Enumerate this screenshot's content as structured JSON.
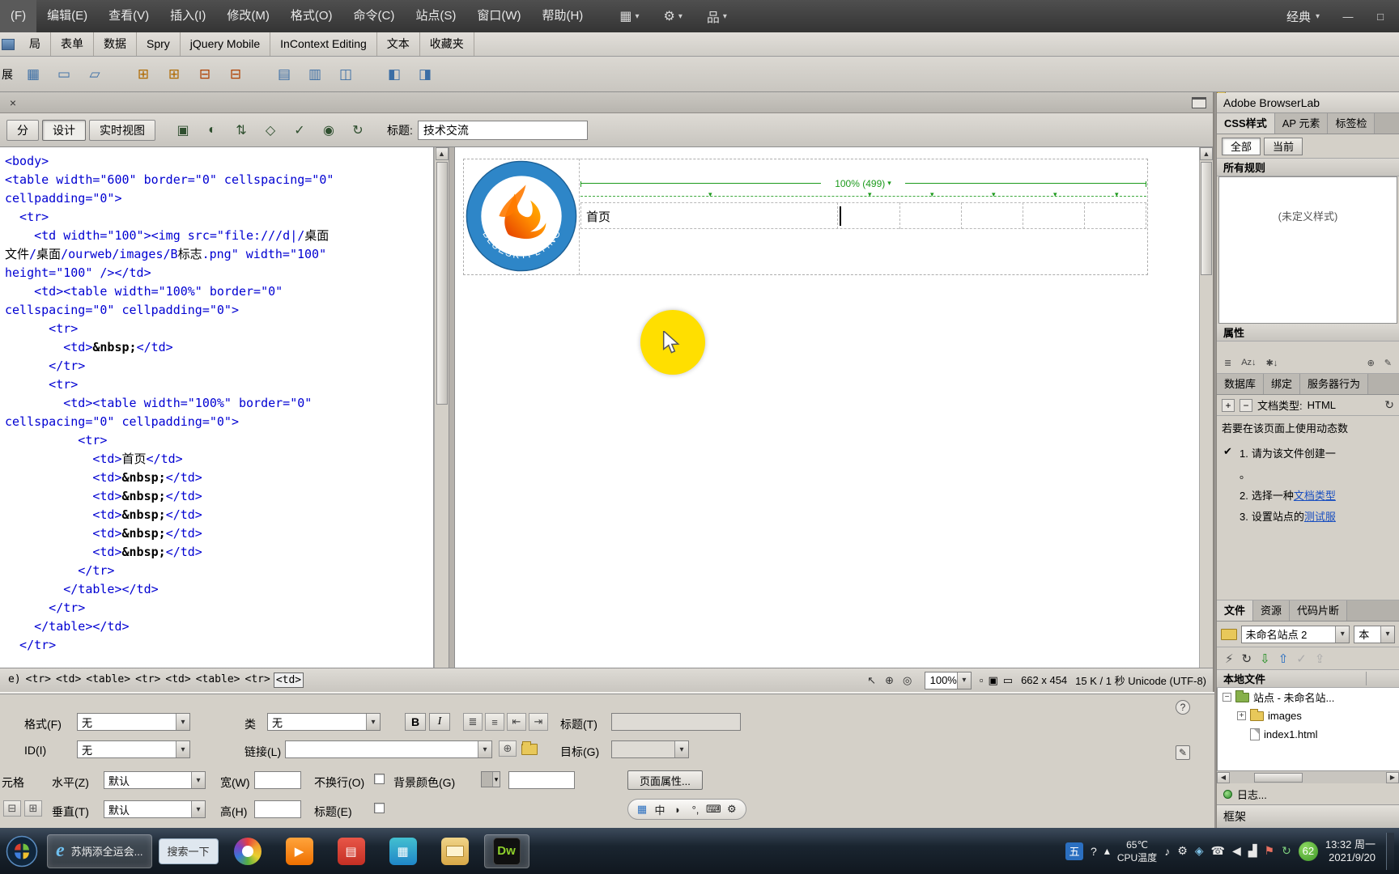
{
  "colors": {
    "guide_green": "#1c9a1c",
    "code_blue": "#0000d2",
    "click_yellow": "#ffdf00"
  },
  "ui": {
    "caret": "▾",
    "up_arrow": "▲",
    "down_arrow": "▼",
    "left_arrow": "◀",
    "right_arrow": "▶"
  },
  "window": {
    "workspace": "经典",
    "minimize": "—",
    "maximize": "□"
  },
  "menubar": {
    "items": [
      "(F)",
      "编辑(E)",
      "查看(V)",
      "插入(I)",
      "修改(M)",
      "格式(O)",
      "命令(C)",
      "站点(S)",
      "窗口(W)",
      "帮助(H)"
    ],
    "icons": [
      {
        "name": "layout-grid-icon",
        "glyph": "▦"
      },
      {
        "name": "extensions-gear-icon",
        "glyph": "⚙"
      },
      {
        "name": "site-structure-icon",
        "glyph": "品"
      }
    ]
  },
  "insert_bar": {
    "tabs": [
      "局",
      "表单",
      "数据",
      "Spry",
      "jQuery Mobile",
      "InContext Editing",
      "文本",
      "收藏夹"
    ]
  },
  "layout_bar": {
    "label": "展",
    "icons": [
      {
        "name": "insert-table-icon",
        "glyph": "▦",
        "color": "#3b6ea5"
      },
      {
        "name": "insert-div-icon",
        "glyph": "▭",
        "color": "#3b6ea5"
      },
      {
        "name": "draw-ap-div-icon",
        "glyph": "▱",
        "color": "#3b6ea5"
      },
      {
        "name": "insert-row-above-icon",
        "glyph": "⊞",
        "color": "#b06a00"
      },
      {
        "name": "insert-row-below-icon",
        "glyph": "⊞",
        "color": "#b06a00"
      },
      {
        "name": "insert-col-left-icon",
        "glyph": "⊟",
        "color": "#b04000"
      },
      {
        "name": "insert-col-right-icon",
        "glyph": "⊟",
        "color": "#b04000"
      },
      {
        "name": "standard-table-mode-icon",
        "glyph": "▤",
        "color": "#3b6ea5"
      },
      {
        "name": "expanded-table-mode-icon",
        "glyph": "▥",
        "color": "#3b6ea5"
      },
      {
        "name": "merge-cells-icon",
        "glyph": "◫",
        "color": "#3b6ea5"
      },
      {
        "name": "frame-left-icon",
        "glyph": "◧",
        "color": "#3b6ea5"
      },
      {
        "name": "frame-right-icon",
        "glyph": "◨",
        "color": "#3b6ea5"
      }
    ]
  },
  "doc": {
    "views": [
      {
        "name": "view-split-button",
        "label": "分",
        "active": false
      },
      {
        "name": "view-design-button",
        "label": "设计",
        "active": true
      },
      {
        "name": "view-live-button",
        "label": "实时视图",
        "active": false
      }
    ],
    "toolbar_icons": [
      {
        "name": "multiscreen-preview-icon",
        "glyph": "▣"
      },
      {
        "name": "preview-in-browser-icon",
        "glyph": "◐"
      },
      {
        "name": "file-management-icon",
        "glyph": "⇅"
      },
      {
        "name": "w3c-validation-icon",
        "glyph": "◇"
      },
      {
        "name": "browser-compatibility-icon",
        "glyph": "✓"
      },
      {
        "name": "visual-aids-icon",
        "glyph": "◉"
      },
      {
        "name": "refresh-design-icon",
        "glyph": "↻"
      }
    ],
    "title_label": "标题:",
    "title_value": "技术交流"
  },
  "code": {
    "lines": [
      "<body>",
      "<table width=\"600\" border=\"0\" cellspacing=\"0\"",
      "cellpadding=\"0\">",
      "  <tr>",
      "    <td width=\"100\"><img src=\"file:///d|/桌面",
      "文件/桌面/ourweb/images/B标志.png\" width=\"100\"",
      "height=\"100\" /></td>",
      "    <td><table width=\"100%\" border=\"0\"",
      "cellspacing=\"0\" cellpadding=\"0\">",
      "      <tr>",
      "        <td>&nbsp;</td>",
      "      </tr>",
      "      <tr>",
      "        <td><table width=\"100%\" border=\"0\"",
      "cellspacing=\"0\" cellpadding=\"0\">",
      "          <tr>",
      "            <td>首页</td>",
      "            <td>&nbsp;</td>",
      "            <td>&nbsp;</td>",
      "            <td>&nbsp;</td>",
      "            <td>&nbsp;</td>",
      "            <td>&nbsp;</td>",
      "          </tr>",
      "        </table></td>",
      "      </tr>",
      "    </table></td>",
      "  </tr>"
    ]
  },
  "design": {
    "logo_text": "BLUESKYFLYING",
    "width_indicator": "100% (499)",
    "nav_item": "首页",
    "cell_boundaries": [
      472,
      549,
      625,
      701,
      777
    ],
    "column_carets": [
      313,
      510,
      587,
      663,
      739,
      815
    ]
  },
  "status": {
    "tag_path": [
      "e)",
      "<tr>",
      "<td>",
      "<table>",
      "<tr>",
      "<td>",
      "<table>",
      "<tr>",
      "<td>"
    ],
    "tools": [
      {
        "name": "select-tool-icon",
        "glyph": "↖"
      },
      {
        "name": "hand-tool-icon",
        "glyph": "⊕"
      },
      {
        "name": "zoom-tool-icon",
        "glyph": "◎"
      }
    ],
    "zoom": "100%",
    "mini_icons": [
      {
        "name": "window-size-icon",
        "glyph": "▫"
      },
      {
        "name": "monitor-size-icon",
        "glyph": "▣"
      },
      {
        "name": "download-size-icon",
        "glyph": "▭"
      }
    ],
    "dimensions": "662 x 454",
    "info": "15 K / 1 秒 Unicode (UTF-8)"
  },
  "properties": {
    "format_label": "格式(F)",
    "format_value": "无",
    "class_label": "类",
    "class_value": "无",
    "bold_label": "B",
    "italic_label": "I",
    "list_icons": [
      {
        "name": "unordered-list-icon",
        "glyph": "≣"
      },
      {
        "name": "ordered-list-icon",
        "glyph": "≡"
      },
      {
        "name": "outdent-icon",
        "glyph": "⇤"
      },
      {
        "name": "indent-icon",
        "glyph": "⇥"
      }
    ],
    "title_label": "标题(T)",
    "id_label": "ID(I)",
    "id_value": "无",
    "link_label": "链接(L)",
    "target_label": "目标(G)",
    "cell_label": "元格",
    "horz_label": "水平(Z)",
    "horz_value": "默认",
    "vert_label": "垂直(T)",
    "vert_value": "默认",
    "width_label": "宽(W)",
    "height_label": "高(H)",
    "nowrap_label": "不换行(O)",
    "header_label": "标题(E)",
    "bg_label": "背景颜色(G)",
    "page_props_label": "页面属性...",
    "help_glyph": "?",
    "edit_glyph": "✎",
    "merge_glyph": "⊟",
    "split_glyph": "⊞"
  },
  "ime_bar": {
    "icons": [
      {
        "name": "ime-logo-icon",
        "glyph": "▦",
        "color": "#2b6fc0"
      },
      {
        "name": "ime-chinese-mode-icon",
        "glyph": "中",
        "color": "#222"
      },
      {
        "name": "ime-halfwidth-icon",
        "glyph": "◗",
        "color": "#222"
      },
      {
        "name": "ime-punctuation-icon",
        "glyph": "°,",
        "color": "#222"
      },
      {
        "name": "ime-keyboard-icon",
        "glyph": "⌨",
        "color": "#222"
      },
      {
        "name": "ime-settings-icon",
        "glyph": "⚙",
        "color": "#222"
      }
    ]
  },
  "dock": {
    "browserlab_title": "Adobe BrowserLab",
    "css_panel_tabs": [
      "CSS样式",
      "AP 元素",
      "标签检"
    ],
    "all_button": "全部",
    "current_button": "当前",
    "all_rules_label": "所有规则",
    "no_style_text": "(未定义样式)",
    "properties_label": "属性",
    "css_toolbar_left": [
      {
        "name": "show-category-view-icon",
        "glyph": "≣"
      },
      {
        "name": "show-list-view-icon",
        "glyph": "Az↓"
      },
      {
        "name": "show-set-properties-icon",
        "glyph": "✱↓"
      }
    ],
    "css_toolbar_right": [
      {
        "name": "new-css-rule-icon",
        "glyph": "⊕"
      },
      {
        "name": "edit-style-icon",
        "glyph": "✎"
      }
    ],
    "server_panel_tabs": [
      "数据库",
      "绑定",
      "服务器行为"
    ],
    "plus_label": "+",
    "minus_label": "−",
    "doctype_label": "文档类型:",
    "doctype_value": "HTML",
    "refresh_glyph": "↻",
    "dynamic_intro": "若要在该页面上使用动态数",
    "check_glyph": "✔",
    "steps": [
      {
        "num": "1.",
        "text": "请为该文件创建一",
        "link": ""
      },
      {
        "num": "2.",
        "text": "选择一种",
        "link": "文档类型"
      },
      {
        "num": "3.",
        "text": "设置站点的",
        "link": "测试服"
      }
    ],
    "step1_tail": "。",
    "files_panel_tabs": [
      "文件",
      "资源",
      "代码片断"
    ],
    "site_select_value": "未命名站点 2",
    "view_select_value": "本",
    "files_toolbar": [
      {
        "name": "connect-icon",
        "glyph": "⚡",
        "color": "#555"
      },
      {
        "name": "refresh-files-icon",
        "glyph": "↻",
        "color": "#333"
      },
      {
        "name": "get-files-icon",
        "glyph": "⇩",
        "color": "#1c8c1c"
      },
      {
        "name": "put-files-icon",
        "glyph": "⇧",
        "color": "#1c66c0"
      },
      {
        "name": "checkout-files-icon",
        "glyph": "✓",
        "color": "#aaa"
      },
      {
        "name": "checkin-files-icon",
        "glyph": "⇪",
        "color": "#aaa"
      }
    ],
    "local_files_header": "本地文件",
    "tree": [
      {
        "level": 0,
        "expander": "−",
        "icon": "site",
        "label": "站点 - 未命名站..."
      },
      {
        "level": 1,
        "expander": "+",
        "icon": "folder",
        "label": "images"
      },
      {
        "level": 1,
        "expander": "",
        "icon": "file",
        "label": "index1.html"
      }
    ],
    "status_text": "日志...",
    "frames_label": "框架"
  },
  "taskbar": {
    "apps": [
      {
        "name": "ie-task-button",
        "type": "ie",
        "glyph": "e",
        "label": "苏炳添全运会..."
      },
      {
        "name": "search-box-button",
        "type": "search",
        "label": "搜索一下"
      },
      {
        "name": "browser-circle-app",
        "type": "circle"
      },
      {
        "name": "video-player-app",
        "type": "play"
      },
      {
        "name": "media-red-app",
        "type": "red"
      },
      {
        "name": "capture-tool-app",
        "type": "teal"
      },
      {
        "name": "folder-app",
        "type": "folder"
      },
      {
        "name": "dreamweaver-app",
        "type": "dw",
        "label": "Dw",
        "active": true
      }
    ],
    "tray": {
      "ime_badge": "五",
      "help_glyph": "?",
      "hidden_icons_glyph": "▴",
      "temp_line1": "65℃",
      "temp_line2": "CPU温度",
      "icons": [
        {
          "name": "microphone-tray-icon",
          "glyph": "♪",
          "color": "#e8e8e8"
        },
        {
          "name": "settings-tray-icon",
          "glyph": "⚙",
          "color": "#e8e8e8"
        },
        {
          "name": "bluetooth-tray-icon",
          "glyph": "◈",
          "color": "#7ec3e8"
        },
        {
          "name": "phone-tray-icon",
          "glyph": "☎",
          "color": "#e8e8e8"
        },
        {
          "name": "volume-tray-icon",
          "glyph": "◀",
          "color": "#e8e8e8"
        },
        {
          "name": "network-tray-icon",
          "glyph": "▟",
          "color": "#e8e8e8"
        },
        {
          "name": "flag-tray-icon",
          "glyph": "⚑",
          "color": "#e87060"
        },
        {
          "name": "sync-tray-icon",
          "glyph": "↻",
          "color": "#7ecf7e"
        }
      ],
      "score_badge": "62",
      "clock_line1": "13:32 周一",
      "clock_line2": "2021/9/20"
    }
  }
}
